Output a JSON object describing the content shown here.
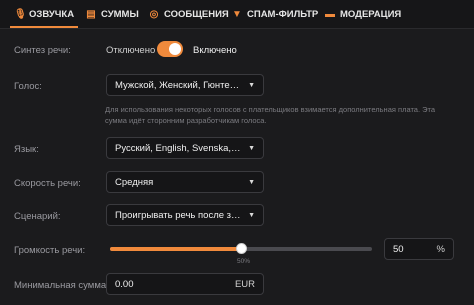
{
  "tabs": [
    {
      "icon": "microphone-icon",
      "glyph": "🎙",
      "label": "ОЗВУЧКА",
      "active": true
    },
    {
      "icon": "coins-icon",
      "glyph": "▤",
      "label": "СУММЫ"
    },
    {
      "icon": "chat-icon",
      "glyph": "◎",
      "label": "СООБЩЕНИЯ"
    },
    {
      "icon": "filter-icon",
      "glyph": "▼",
      "label": "СПАМ-ФИЛЬТР"
    },
    {
      "icon": "moderation-icon",
      "glyph": "▬",
      "label": "МОДЕРАЦИЯ"
    }
  ],
  "speech_synthesis": {
    "label": "Синтез речи:",
    "off_label": "Отключено",
    "on_label": "Включено",
    "enabled": true
  },
  "voice": {
    "label": "Голос:",
    "value": "Мужской, Женский, Гюнтер О'Д...",
    "note": "Для использования некоторых голосов с плательщиков взимается дополнительная плата. Эта сумма идёт сторонним разработчикам голоса."
  },
  "language": {
    "label": "Язык:",
    "value": "Русский, English, Svenska, Franç..."
  },
  "speed": {
    "label": "Скорость речи:",
    "value": "Средняя"
  },
  "scenario": {
    "label": "Сценарий:",
    "value": "Проигрывать речь после звука о..."
  },
  "volume": {
    "label": "Громкость речи:",
    "value": 50,
    "percent_label": "50%",
    "unit": "%",
    "input_value": "50"
  },
  "min_amount": {
    "label": "Минимальная сумма:",
    "value": "0.00",
    "currency": "EUR"
  },
  "colors": {
    "accent": "#f08a3c",
    "background": "#1b1b1d"
  }
}
